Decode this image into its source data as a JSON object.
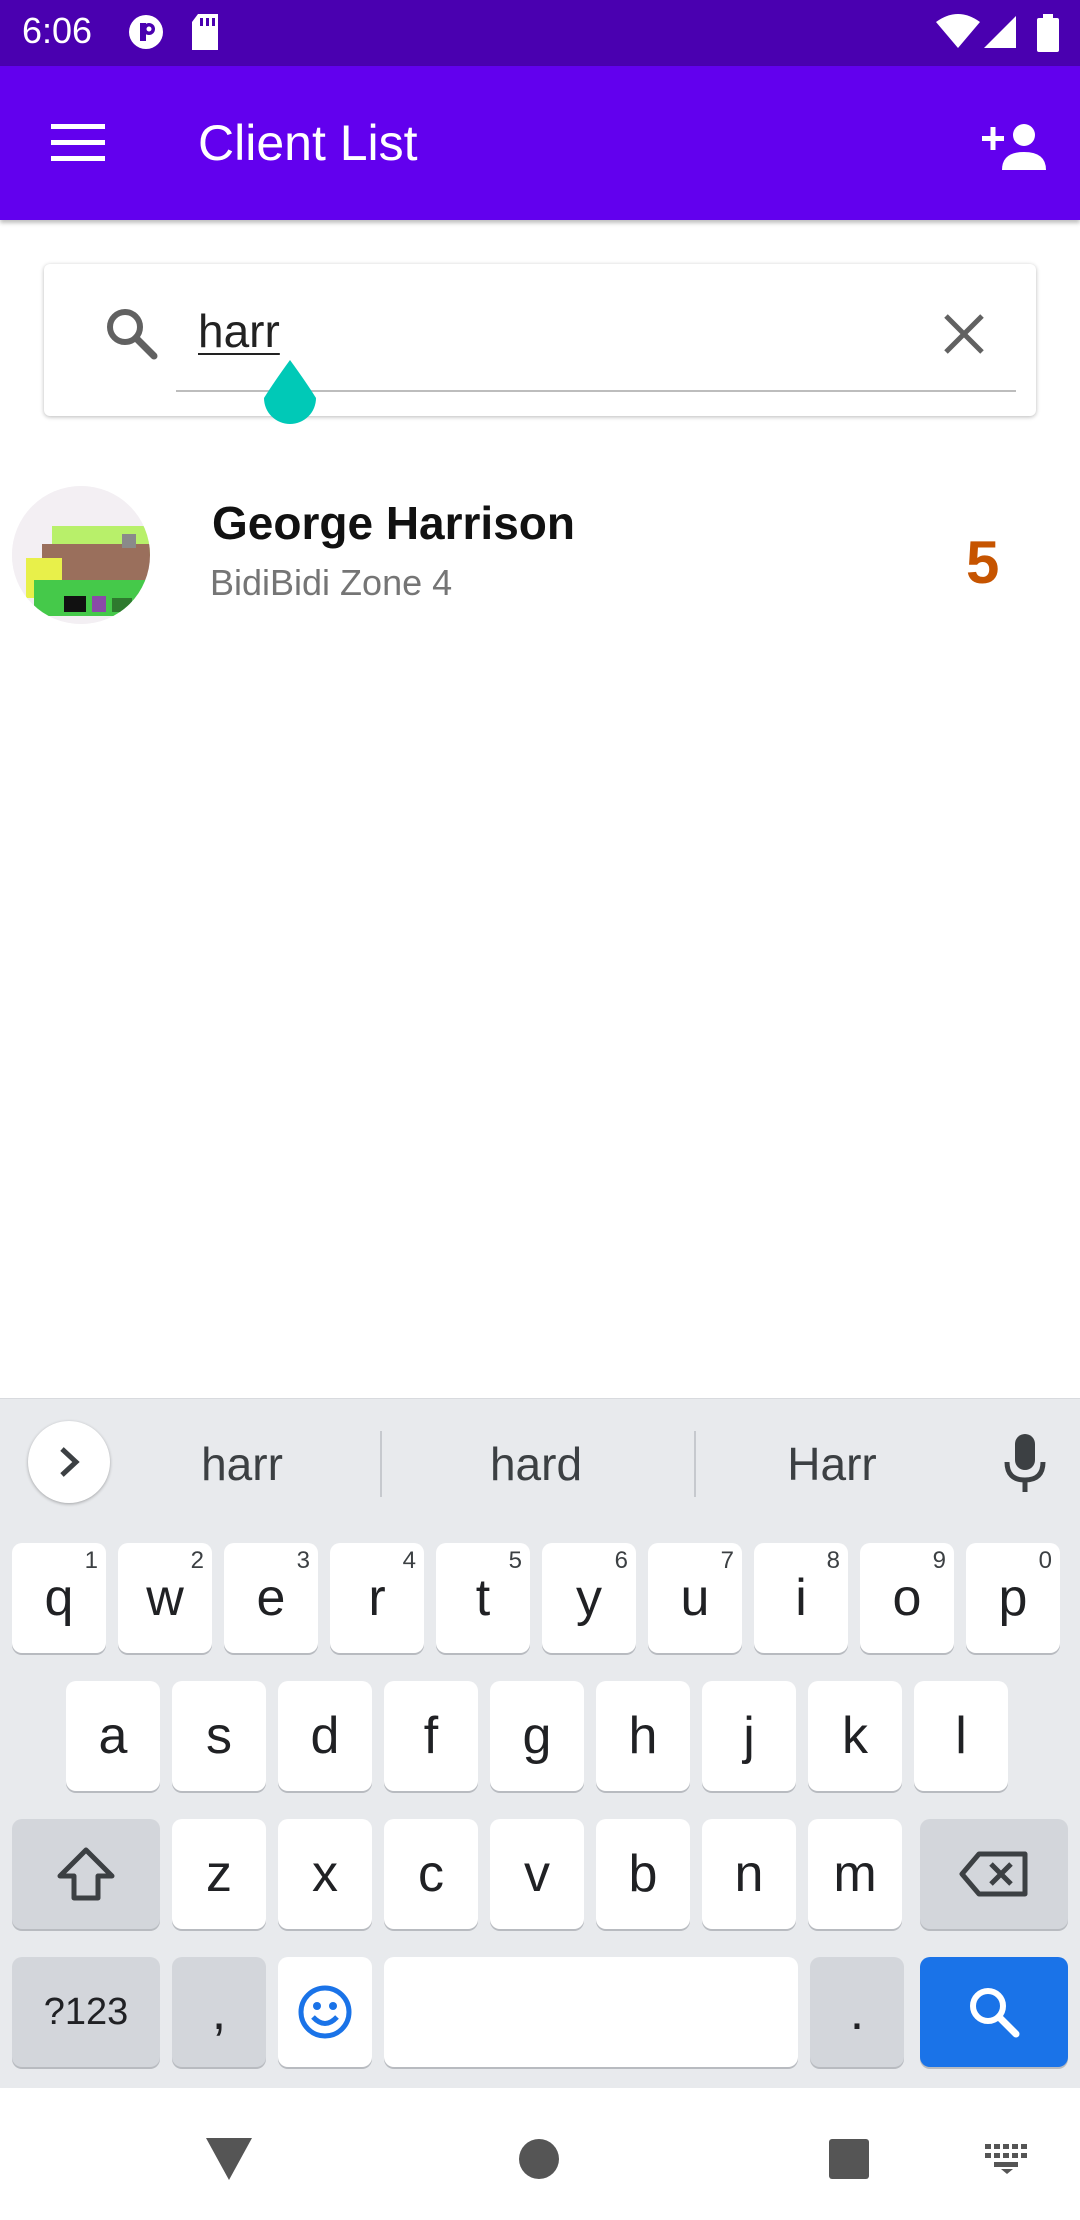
{
  "status_bar": {
    "time": "6:06",
    "colors": {
      "background": "#4a00b0"
    }
  },
  "app_bar": {
    "title": "Client List",
    "colors": {
      "background": "#6200ee"
    }
  },
  "search": {
    "value": "harr",
    "placeholder": ""
  },
  "clients": [
    {
      "name": "George Harrison",
      "zone": "BidiBidi Zone 4",
      "count": "5",
      "count_color": "#c65400"
    }
  ],
  "keyboard": {
    "suggestions": [
      "harr",
      "hard",
      "Harr"
    ],
    "row1": [
      {
        "key": "q",
        "hint": "1"
      },
      {
        "key": "w",
        "hint": "2"
      },
      {
        "key": "e",
        "hint": "3"
      },
      {
        "key": "r",
        "hint": "4"
      },
      {
        "key": "t",
        "hint": "5"
      },
      {
        "key": "y",
        "hint": "6"
      },
      {
        "key": "u",
        "hint": "7"
      },
      {
        "key": "i",
        "hint": "8"
      },
      {
        "key": "o",
        "hint": "9"
      },
      {
        "key": "p",
        "hint": "0"
      }
    ],
    "row2": [
      "a",
      "s",
      "d",
      "f",
      "g",
      "h",
      "j",
      "k",
      "l"
    ],
    "row3": [
      "z",
      "x",
      "c",
      "v",
      "b",
      "n",
      "m"
    ],
    "symbols_label": "?123",
    "comma_label": ",",
    "period_label": ".",
    "action_color": "#1a73e8"
  },
  "icons": [
    "menu-icon",
    "add-person-icon",
    "search-icon",
    "close-icon",
    "chevron-right-icon",
    "mic-icon",
    "shift-icon",
    "backspace-icon",
    "emoji-icon",
    "search-action-icon",
    "back-icon",
    "home-icon",
    "recents-icon",
    "keyboard-switch-icon"
  ]
}
